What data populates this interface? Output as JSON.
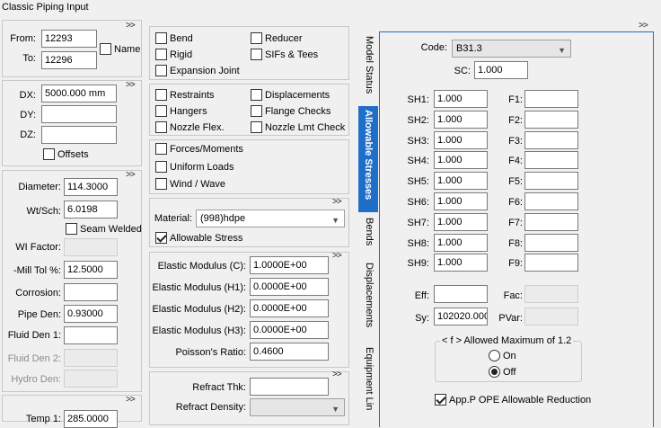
{
  "window": {
    "title": "Classic Piping Input"
  },
  "chevron": ">>",
  "nodes": {
    "from_label": "From:",
    "from_value": "12293",
    "to_label": "To:",
    "to_value": "12296",
    "name_label": "Name"
  },
  "delta": {
    "dx_label": "DX:",
    "dx_value": "5000.000 mm",
    "dy_label": "DY:",
    "dy_value": "",
    "dz_label": "DZ:",
    "dz_value": "",
    "offsets_label": "Offsets"
  },
  "pipe": {
    "diameter_label": "Diameter:",
    "diameter_value": "114.3000",
    "wtsch_label": "Wt/Sch:",
    "wtsch_value": "6.0198",
    "seam_welded_label": "Seam Welded",
    "wi_factor_label": "WI Factor:",
    "mill_tol_label": "-Mill Tol %:",
    "mill_tol_value": "12.5000",
    "corrosion_label": "Corrosion:",
    "corrosion_value": "",
    "pipe_den_label": "Pipe Den:",
    "pipe_den_value": "0.93000",
    "fluid_den1_label": "Fluid Den 1:",
    "fluid_den1_value": "",
    "fluid_den2_label": "Fluid Den 2:",
    "hydro_den_label": "Hydro Den:",
    "temp1_label": "Temp 1:",
    "temp1_value": "285.0000"
  },
  "options_group1": {
    "bend": "Bend",
    "reducer": "Reducer",
    "rigid": "Rigid",
    "sifs_tees": "SIFs & Tees",
    "expansion_joint": "Expansion Joint"
  },
  "options_group2": {
    "restraints": "Restraints",
    "displacements": "Displacements",
    "hangers": "Hangers",
    "flange_checks": "Flange Checks",
    "nozzle_flex": "Nozzle Flex.",
    "nozzle_lmt_check": "Nozzle Lmt Check"
  },
  "options_group3": {
    "forces_moments": "Forces/Moments",
    "uniform_loads": "Uniform Loads",
    "wind_wave": "Wind / Wave"
  },
  "material": {
    "material_label": "Material:",
    "material_value": "(998)hdpe",
    "allowable_stress_label": "Allowable Stress"
  },
  "elastic": {
    "em_c_label": "Elastic Modulus (C):",
    "em_c_value": "1.0000E+00",
    "em_h1_label": "Elastic Modulus (H1):",
    "em_h1_value": "0.0000E+00",
    "em_h2_label": "Elastic Modulus (H2):",
    "em_h2_value": "0.0000E+00",
    "em_h3_label": "Elastic Modulus (H3):",
    "em_h3_value": "0.0000E+00",
    "poisson_label": "Poisson's Ratio:",
    "poisson_value": "0.4600"
  },
  "refract": {
    "thk_label": "Refract Thk:",
    "thk_value": "",
    "density_label": "Refract Density:",
    "density_value": ""
  },
  "tabs": {
    "model_status": "Model Status",
    "allowable_stresses": "Allowable Stresses",
    "bends": "Bends",
    "displacements": "Displacements",
    "equipment": "Equipment Lin"
  },
  "allowable": {
    "code_label": "Code:",
    "code_value": "B31.3",
    "sc_label": "SC:",
    "sc_value": "1.000",
    "sh": [
      {
        "label": "SH1:",
        "value": "1.000"
      },
      {
        "label": "SH2:",
        "value": "1.000"
      },
      {
        "label": "SH3:",
        "value": "1.000"
      },
      {
        "label": "SH4:",
        "value": "1.000"
      },
      {
        "label": "SH5:",
        "value": "1.000"
      },
      {
        "label": "SH6:",
        "value": "1.000"
      },
      {
        "label": "SH7:",
        "value": "1.000"
      },
      {
        "label": "SH8:",
        "value": "1.000"
      },
      {
        "label": "SH9:",
        "value": "1.000"
      }
    ],
    "f": [
      {
        "label": "F1:"
      },
      {
        "label": "F2:"
      },
      {
        "label": "F3:"
      },
      {
        "label": "F4:"
      },
      {
        "label": "F5:"
      },
      {
        "label": "F6:"
      },
      {
        "label": "F7:"
      },
      {
        "label": "F8:"
      },
      {
        "label": "F9:"
      }
    ],
    "eff_label": "Eff:",
    "eff_value": "",
    "fac_label": "Fac:",
    "sy_label": "Sy:",
    "sy_value": "102020.000",
    "pvar_label": "PVar:",
    "allowed_max_label": "< f > Allowed Maximum of 1.2",
    "on_label": "On",
    "off_label": "Off",
    "app_p_label": "App.P OPE Allowable Reduction"
  },
  "colors": {
    "active_tab": "#1f6fc8",
    "window_bg": "#f0f0f0"
  }
}
